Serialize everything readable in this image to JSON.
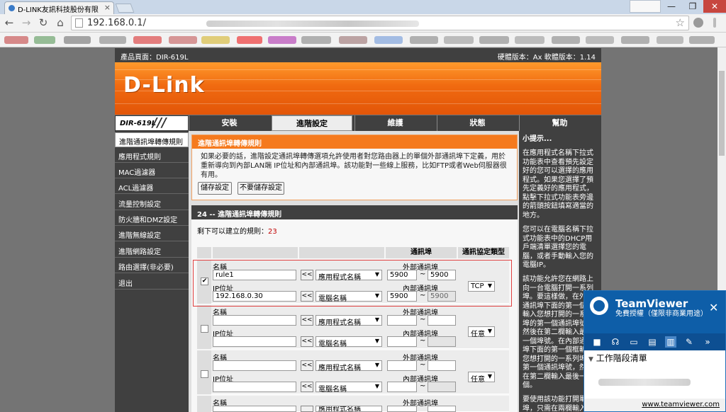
{
  "browser": {
    "tab_title": "D-LINK友訊科技股份有限",
    "tab_close": "×",
    "url": "192.168.0.1/",
    "window_controls": {
      "minimize": "—",
      "maximize": "❐",
      "close": "✕"
    }
  },
  "header": {
    "product_page": "產品頁面：DIR-619L",
    "version_info": "硬體版本：Ax   軟體版本：1.14",
    "logo": "D-Link",
    "model": "DIR-619L"
  },
  "menu": [
    {
      "label": "安裝"
    },
    {
      "label": "進階設定"
    },
    {
      "label": "維護"
    },
    {
      "label": "狀態"
    },
    {
      "label": "幫助"
    }
  ],
  "sidebar": [
    {
      "label": "進階通訊埠轉傳規則"
    },
    {
      "label": "應用程式規則"
    },
    {
      "label": "MAC過濾器"
    },
    {
      "label": "ACL過濾器"
    },
    {
      "label": "流量控制設定"
    },
    {
      "label": "防火牆和DMZ設定"
    },
    {
      "label": "進階無線設定"
    },
    {
      "label": "進階網路設定"
    },
    {
      "label": "路由選擇(非必要)"
    },
    {
      "label": "退出"
    }
  ],
  "intro": {
    "title": "進階通訊埠轉傳規則",
    "text": "如果必要的話，進階設定通訊埠轉傳選項允許使用者對您路由器上的單個外部通訊埠下定義，用於重新導向到內部LAN端 IP位址和內部通訊埠。該功能對一些線上服務，比如FTP或者Web伺服器很有用。",
    "save_label": "儲存設定",
    "nosave_label": "不要儲存設定"
  },
  "rules": {
    "title": "24 -- 進階通訊埠轉傳規則",
    "remaining_label": "剩下可以建立的規則：",
    "remaining_count": "23",
    "col_port": "通訊埠",
    "col_protocol": "通訊協定類型",
    "label_name": "名稱",
    "label_ip": "IP位址",
    "label_ext": "外部通訊埠",
    "label_int": "內部通訊埠",
    "arrow": "<<",
    "tilde": "~",
    "app_select": "應用程式名稱",
    "pc_select": "電腦名稱",
    "rows": [
      {
        "checked": "✔",
        "name": "rule1",
        "ip": "192.168.0.30",
        "ext_start": "5900",
        "ext_end": "5900",
        "int_start": "5900",
        "int_end": "5900",
        "protocol": "TCP"
      },
      {
        "checked": "",
        "name": "",
        "ip": "",
        "ext_start": "",
        "ext_end": "",
        "int_start": "",
        "int_end": "",
        "protocol": "任意"
      },
      {
        "checked": "",
        "name": "",
        "ip": "",
        "ext_start": "",
        "ext_end": "",
        "int_start": "",
        "int_end": "",
        "protocol": "任意"
      },
      {
        "checked": "",
        "name": "",
        "ip": "",
        "ext_start": "",
        "ext_end": "",
        "int_start": "",
        "int_end": "",
        "protocol": ""
      }
    ]
  },
  "tips": {
    "title": "小提示...",
    "p1": "在應用程式名稱下拉式功能表中查看預先設定好的您可以選擇的應用程式。如果您選擇了預先定義好的應用程式，點擊下拉式功能表旁邊的箭頭按鈕填寫適當的地方。",
    "p2": "您可以在電腦名稱下拉式功能表中的DHCP用戶端清單選擇您的電腦，或者手動輸入您的電腦IP。",
    "p3": "該功能允許您在網路上向一台電腦打開一系列埠。要這樣做，在外部通訊埠下面的第一個框輸入您想打開的一系列埠的第一個通訊埠號，然後在第二欄輸入最後一個埠號。在內部通訊埠下面的第一個框輸入您想打開的一系列埠的第一個通訊埠號，然後在第二欄輸入最後一個。",
    "p4": "要使用該功能打開單一埠，只需在兩欄輸入"
  },
  "teamviewer": {
    "title": "TeamViewer",
    "subtitle": "免費授權（僅限非商業用途）",
    "close": "✕",
    "session_list": "工作階段清單",
    "footer": "www.teamviewer.com"
  }
}
